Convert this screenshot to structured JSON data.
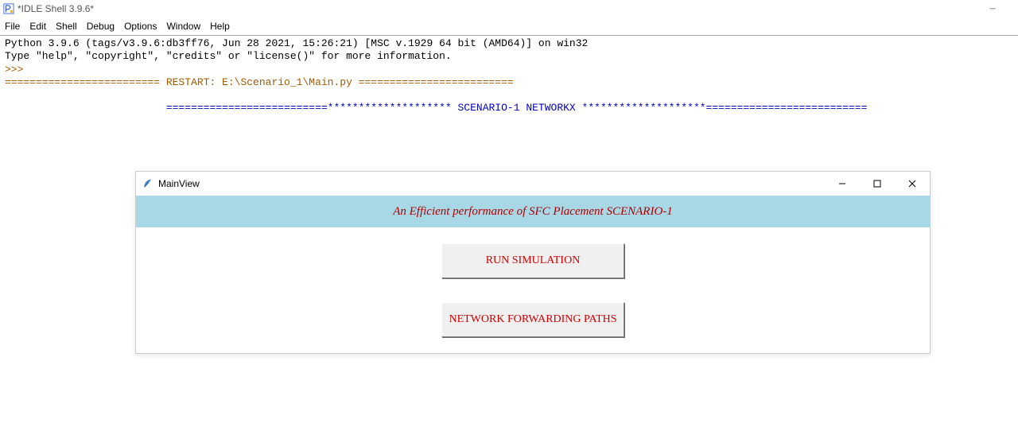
{
  "idle": {
    "title": "*IDLE Shell 3.9.6*",
    "menus": [
      "File",
      "Edit",
      "Shell",
      "Debug",
      "Options",
      "Window",
      "Help"
    ],
    "console": {
      "line1": "Python 3.9.6 (tags/v3.9.6:db3ff76, Jun 28 2021, 15:26:21) [MSC v.1929 64 bit (AMD64)] on win32",
      "line2": "Type \"help\", \"copyright\", \"credits\" or \"license()\" for more information.",
      "prompt": ">>> ",
      "restart": "========================= RESTART: E:\\Scenario_1\\Main.py =========================",
      "scenario_prefix": "                          ==========================******************** ",
      "scenario_label": "SCENARIO-1 NETWORKX",
      "scenario_suffix": " ********************=========================="
    }
  },
  "mainview": {
    "title": "MainView",
    "header": "An Efficient performance of SFC Placement SCENARIO-1",
    "button1": "RUN SIMULATION",
    "button2": "NETWORK FORWARDING PATHS"
  }
}
